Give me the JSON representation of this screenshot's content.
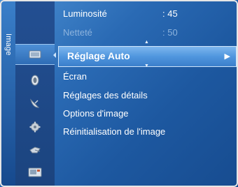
{
  "tab": {
    "label": "Image"
  },
  "icons": [
    "tv-picture-icon",
    "sound-icon",
    "satellite-dish-icon",
    "settings-gear-icon",
    "input-plug-icon",
    "application-icon"
  ],
  "menu": {
    "rows_above": [
      {
        "label": "Luminosité",
        "value": ": 45",
        "dim": false
      },
      {
        "label": "Netteté",
        "value": ": 50",
        "dim": true
      }
    ],
    "selected": {
      "label": "Réglage Auto",
      "arrow": "▶"
    },
    "items": [
      {
        "label": "Écran"
      },
      {
        "label": "Réglages des détails"
      },
      {
        "label": "Options d'image"
      },
      {
        "label": "Réinitialisation de l'image"
      }
    ],
    "scroll_up": "▲",
    "scroll_down": "▼"
  },
  "colors": {
    "background": "#1d58a0",
    "selection": "#5096de",
    "text": "#ffffff",
    "dim_text": "#8db3dd"
  }
}
